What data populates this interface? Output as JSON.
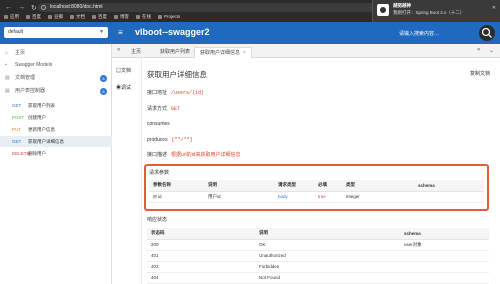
{
  "browser": {
    "address": "localhost:8080/doc.html",
    "nav": [
      "←",
      "→",
      "↻"
    ],
    "bookmarks": [
      "应用",
      "百度",
      "豆瓣",
      "文档",
      "百度",
      "博客",
      "在线",
      "Projects"
    ]
  },
  "notification": {
    "title": "越努越神",
    "text": "我刚打开：Spring Boot 2.x（十二）·",
    "close": "✕"
  },
  "header": {
    "group_select": "default",
    "title": "vlboot--swagger2",
    "search_hint": "请输入搜索内容…",
    "hamburger": "≡"
  },
  "sidebar": {
    "home": "主页",
    "models": "Swagger Models",
    "doc_mgmt": "文档管理",
    "doc_mgmt_badge": "5",
    "user_api": "用户表控制器",
    "user_api_badge": "5",
    "items": [
      {
        "method": "GET",
        "label": "获取用户列表"
      },
      {
        "method": "POST",
        "label": "创建用户"
      },
      {
        "method": "PUT",
        "label": "更新用户信息"
      },
      {
        "method": "GET",
        "label": "获取用户详细信息"
      },
      {
        "method": "DELETE",
        "label": "删除用户"
      }
    ]
  },
  "tabs": {
    "left_arrow": "«",
    "items": [
      "主页",
      "获取用户列表",
      "获取用户详细信息"
    ],
    "close": "×",
    "right_arrow": "»",
    "more": "⌄"
  },
  "doc_nav": [
    "文档",
    "调试"
  ],
  "content": {
    "title": "获取用户详细信息",
    "copy_doc": "复制文档",
    "url_label": "接口地址",
    "url_value": "/users/{id}",
    "method_label": "请求方式",
    "method_value": "GET",
    "consumes_label": "consumes",
    "produces_label": "produces",
    "produces_value": "[\"*/*\"]",
    "desc_label": "接口描述",
    "desc_value": "根据url的id来获取用户详细信息",
    "params_title": "请求参数",
    "params_headers": [
      "参数名称",
      "说明",
      "请求类型",
      "必填",
      "类型",
      "schema"
    ],
    "params_rows": [
      {
        "expand": "⊟",
        "name": "id",
        "desc": "用户id",
        "in": "body",
        "required": "true",
        "type": "integer",
        "schema": ""
      }
    ],
    "responses_title": "响应状态",
    "resp_headers": [
      "状态码",
      "说明",
      "schema"
    ],
    "resp_rows": [
      {
        "code": "200",
        "desc": "OK",
        "schema": "user对象"
      },
      {
        "code": "401",
        "desc": "Unauthorized",
        "schema": ""
      },
      {
        "code": "403",
        "desc": "Forbidden",
        "schema": ""
      },
      {
        "code": "404",
        "desc": "Not Found",
        "schema": ""
      }
    ]
  }
}
